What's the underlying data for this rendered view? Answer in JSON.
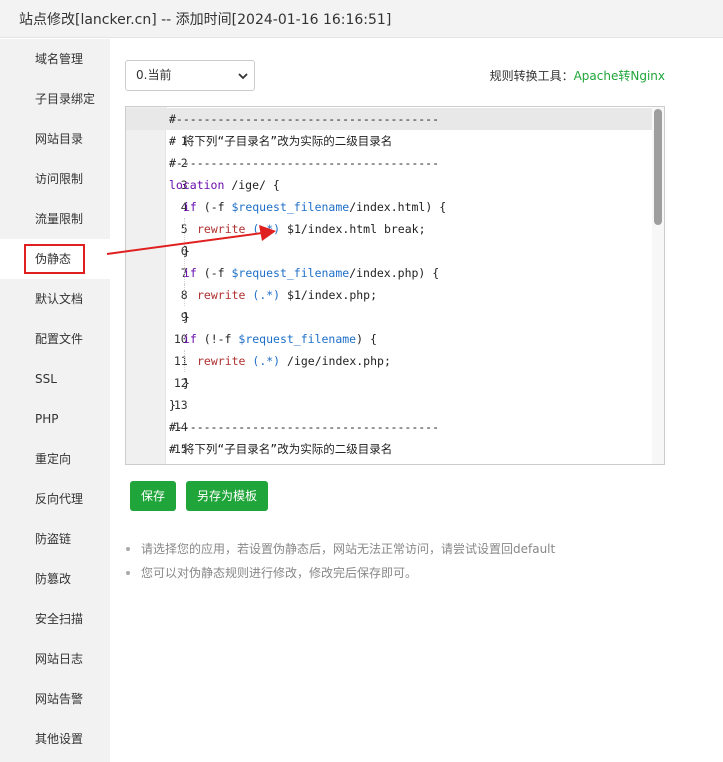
{
  "window": {
    "title": "站点修改[lancker.cn] -- 添加时间[2024-01-16 16:16:51]"
  },
  "sidebar": {
    "items": [
      {
        "label": "域名管理"
      },
      {
        "label": "子目录绑定"
      },
      {
        "label": "网站目录"
      },
      {
        "label": "访问限制"
      },
      {
        "label": "流量限制"
      },
      {
        "label": "伪静态"
      },
      {
        "label": "默认文档"
      },
      {
        "label": "配置文件"
      },
      {
        "label": "SSL"
      },
      {
        "label": "PHP"
      },
      {
        "label": "重定向"
      },
      {
        "label": "反向代理"
      },
      {
        "label": "防盗链"
      },
      {
        "label": "防篡改"
      },
      {
        "label": "安全扫描"
      },
      {
        "label": "网站日志"
      },
      {
        "label": "网站告警"
      },
      {
        "label": "其他设置"
      }
    ],
    "active": "伪静态"
  },
  "toolbar": {
    "version_select": "0.当前",
    "tool_label": "规则转换工具：",
    "tool_link": "Apache转Nginx"
  },
  "editor": {
    "line_numbers": [
      "1",
      "2",
      "3",
      "4",
      "5",
      "6",
      "7",
      "8",
      "9",
      "10",
      "11",
      "12",
      "13",
      "14",
      "15",
      "16"
    ],
    "lines": {
      "l1": "#--------------------------------------",
      "l2": "# 将下列“子目录名”改为实际的二级目录名",
      "l3": "#--------------------------------------",
      "l4_kw": "location",
      "l4_rest": " /ige/ {",
      "l5_kw": "if",
      "l5_a": " (-f ",
      "l5_var": "$request_filename",
      "l5_b": "/index.html) {",
      "l6_kw": "rewrite",
      "l6_re": " (.*)",
      "l6_rest": " $1/index.html break;",
      "l7": "}",
      "l8_kw": "if",
      "l8_a": " (-f ",
      "l8_var": "$request_filename",
      "l8_b": "/index.php) {",
      "l9_kw": "rewrite",
      "l9_re": " (.*)",
      "l9_rest": " $1/index.php;",
      "l10": "}",
      "l11_kw": "if",
      "l11_a": " (!-f ",
      "l11_var": "$request_filename",
      "l11_b": ") {",
      "l12_kw": "rewrite",
      "l12_re": " (.*)",
      "l12_rest": " /ige/index.php;",
      "l13": "}",
      "l14": "}",
      "l15": "#--------------------------------------",
      "l16": "# 将下列“子目录名”改为实际的二级目录名"
    }
  },
  "actions": {
    "save_label": "保存",
    "save_template_label": "另存为模板"
  },
  "tips": [
    "请选择您的应用，若设置伪静态后，网站无法正常访问，请尝试设置回default",
    "您可以对伪静态规则进行修改，修改完后保存即可。"
  ],
  "colors": {
    "accent": "#20a53a",
    "highlight_box": "#e02020",
    "sidebar_bg": "#f2f2f2"
  }
}
